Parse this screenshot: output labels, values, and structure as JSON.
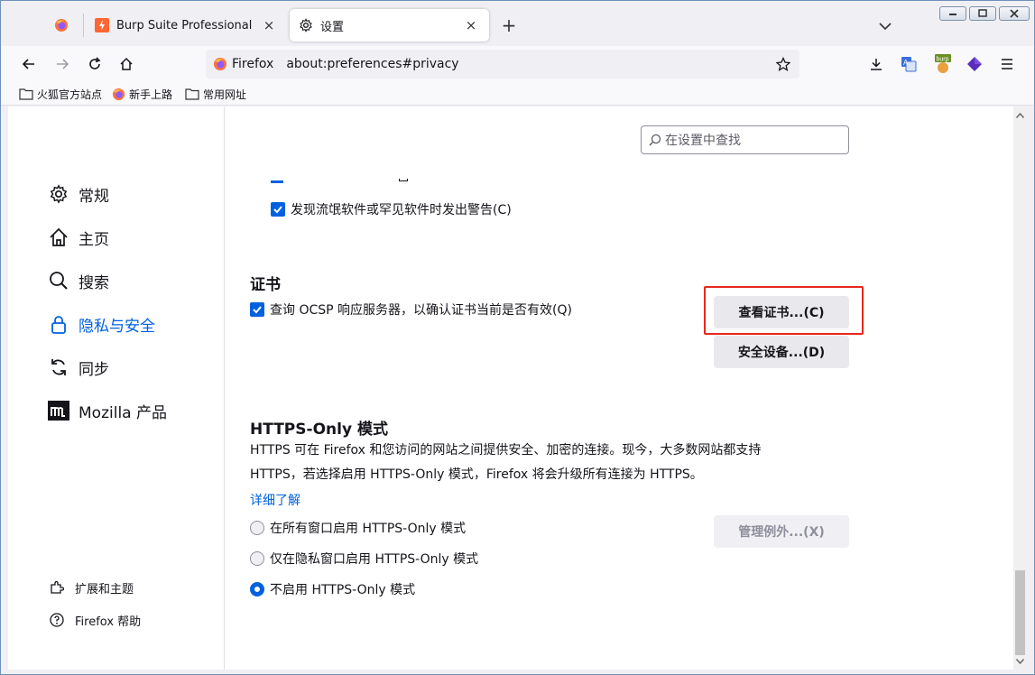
{
  "tabs": [
    {
      "title": "Burp Suite Professional",
      "close": "×"
    },
    {
      "title": "设置",
      "close": "×"
    }
  ],
  "new_tab": "+",
  "urlbar": {
    "identity": "Firefox",
    "url": "about:preferences#privacy"
  },
  "bookmarks": [
    "火狐官方站点",
    "新手上路",
    "常用网址"
  ],
  "sidebar": {
    "categories": [
      {
        "label": "常规",
        "icon": "gear-icon"
      },
      {
        "label": "主页",
        "icon": "home-icon"
      },
      {
        "label": "搜索",
        "icon": "search-icon"
      },
      {
        "label": "隐私与安全",
        "icon": "lock-icon"
      },
      {
        "label": "同步",
        "icon": "sync-icon"
      },
      {
        "label": "Mozilla 产品",
        "icon": "mozilla-icon"
      }
    ],
    "footer": [
      {
        "label": "扩展和主题",
        "icon": "puzzle-icon"
      },
      {
        "label": "Firefox 帮助",
        "icon": "help-icon"
      }
    ]
  },
  "search": {
    "placeholder": "在设置中查找"
  },
  "malware_warning": "发现流氓软件或罕见软件时发出警告(C)",
  "certificates": {
    "heading": "证书",
    "ocsp": "查询 OCSP 响应服务器，以确认证书当前是否有效(Q)",
    "view_button": "查看证书...(C)",
    "devices_button": "安全设备...(D)"
  },
  "https_only": {
    "heading": "HTTPS-Only 模式",
    "desc_line1": "HTTPS 可在 Firefox 和您访问的网站之间提供安全、加密的连接。现今，大多数网站都支持",
    "desc_line2": "HTTPS，若选择启用 HTTPS-Only 模式，Firefox 将会升级所有连接为 HTTPS。",
    "learn_more": "详细了解",
    "exceptions_button": "管理例外...(X)",
    "options": [
      {
        "label": "在所有窗口启用 HTTPS-Only 模式",
        "selected": false
      },
      {
        "label": "仅在隐私窗口启用 HTTPS-Only 模式",
        "selected": false
      },
      {
        "label": "不启用 HTTPS-Only 模式",
        "selected": true
      }
    ]
  },
  "colors": {
    "accent": "#0061e0",
    "highlight": "#e8271f",
    "burp": "#ff6633"
  }
}
